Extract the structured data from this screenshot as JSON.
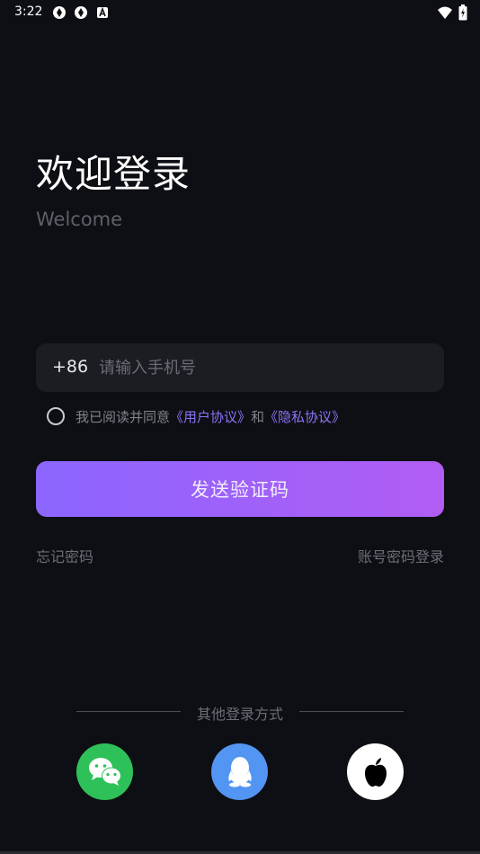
{
  "status_bar": {
    "time": "3:22",
    "left_icons": [
      "sync-icon",
      "sync-icon",
      "notification-a-icon"
    ],
    "right_icons": [
      "wifi-icon",
      "battery-charging-icon"
    ]
  },
  "header": {
    "title": "欢迎登录",
    "subtitle": "Welcome"
  },
  "phone": {
    "country_code": "+86",
    "placeholder": "请输入手机号",
    "value": ""
  },
  "agreement": {
    "checked": false,
    "prefix": "我已阅读并同意",
    "user_agreement": "《用户协议》",
    "joiner": "和",
    "privacy_policy": "《隐私协议》"
  },
  "send_button": {
    "label": "发送验证码"
  },
  "links": {
    "forgot_password": "忘记密码",
    "password_login": "账号密码登录"
  },
  "other_login": {
    "title": "其他登录方式",
    "providers": [
      "wechat-icon",
      "qq-icon",
      "apple-icon"
    ]
  },
  "colors": {
    "background": "#0e0f14",
    "accent_start": "#8b66ff",
    "accent_end": "#b15df3",
    "link": "#8a74f5",
    "wechat": "#2fc159",
    "qq": "#5395f2"
  }
}
